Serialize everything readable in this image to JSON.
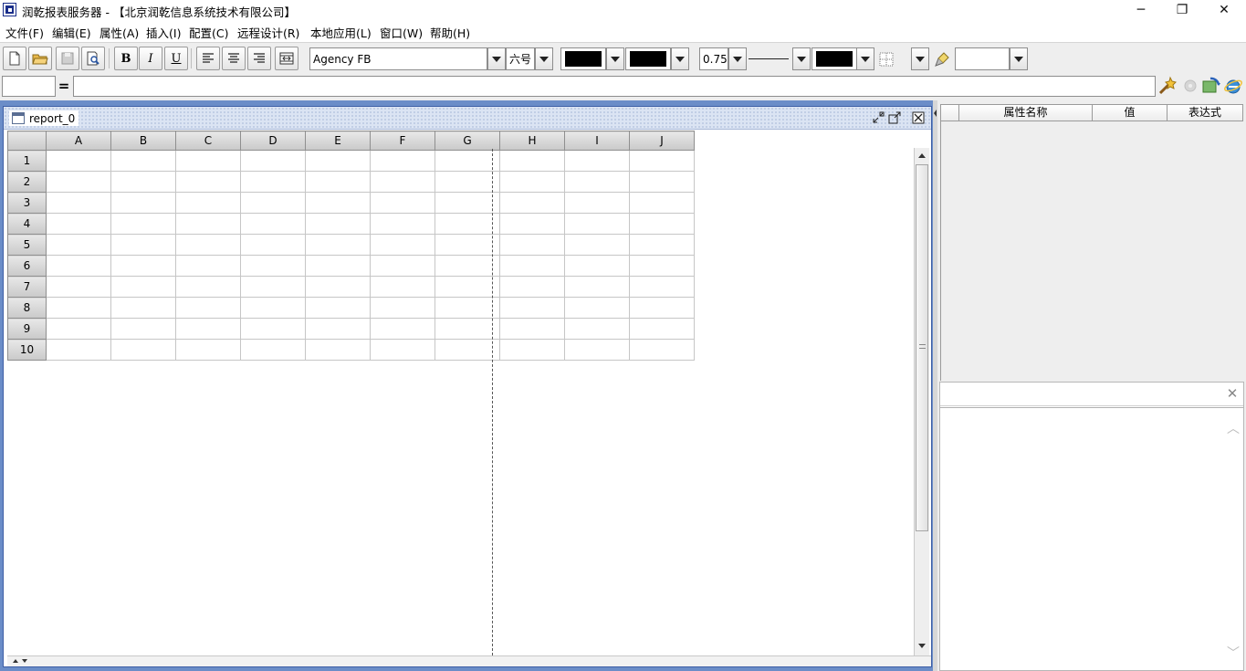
{
  "window": {
    "title": "润乾报表服务器 - 【北京润乾信息系统技术有限公司】",
    "controls": [
      "─",
      "❐",
      "✕"
    ]
  },
  "menu": [
    "文件(F)",
    "编辑(E)",
    "属性(A)",
    "插入(I)",
    "配置(C)",
    "远程设计(R)",
    "本地应用(L)",
    "窗口(W)",
    "帮助(H)"
  ],
  "toolbar": {
    "bold": "B",
    "italic": "I",
    "underline": "U",
    "font_name": "Agency FB",
    "font_size": "六号",
    "line_width": "0.75",
    "fore_color": "#000000",
    "back_color": "#000000",
    "border_color": "#000000"
  },
  "formula_bar": {
    "cell_ref": "",
    "equals": "=",
    "formula": ""
  },
  "report": {
    "tab_title": "report_0",
    "columns": [
      "A",
      "B",
      "C",
      "D",
      "E",
      "F",
      "G",
      "H",
      "I",
      "J"
    ],
    "rows": [
      "1",
      "2",
      "3",
      "4",
      "5",
      "6",
      "7",
      "8",
      "9",
      "10"
    ]
  },
  "property_panel": {
    "headers": [
      "",
      "属性名称",
      "值",
      "表达式"
    ]
  },
  "colors": {
    "desktop": "#6b8dc8",
    "panel_bg": "#eeeeee",
    "frame_border": "#3d5ea5"
  }
}
